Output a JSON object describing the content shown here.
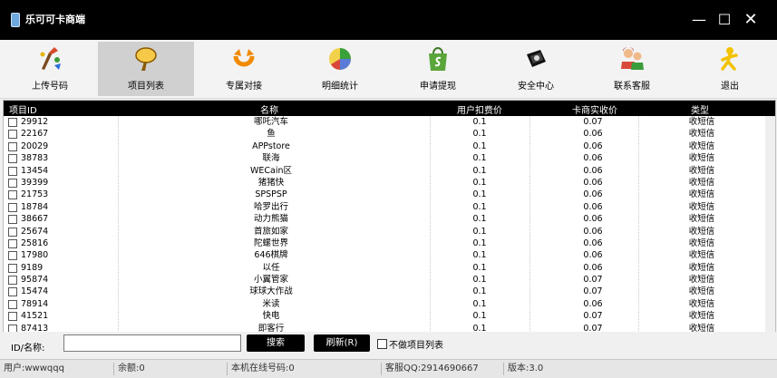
{
  "window": {
    "title": "乐可可卡商端",
    "minimize": "—",
    "maximize": "☐",
    "close": "✕"
  },
  "toolbar": [
    {
      "label": "上传号码",
      "icon": "upload-icon"
    },
    {
      "label": "项目列表",
      "icon": "magnifier-icon",
      "active": true
    },
    {
      "label": "专属对接",
      "icon": "dock-icon"
    },
    {
      "label": "明细统计",
      "icon": "pie-chart-icon"
    },
    {
      "label": "申请提现",
      "icon": "shopify-bag-icon"
    },
    {
      "label": "安全中心",
      "icon": "security-icon"
    },
    {
      "label": "联系客服",
      "icon": "support-icon"
    },
    {
      "label": "退出",
      "icon": "exit-icon"
    }
  ],
  "table": {
    "headers": {
      "id": "项目ID",
      "name": "名称",
      "price": "用户扣费价",
      "cost": "卡商实收价",
      "type": "类型"
    },
    "rows": [
      [
        "29912",
        "哪吒汽车",
        "0.1",
        "0.07",
        "收短信"
      ],
      [
        "22167",
        "鱼",
        "0.1",
        "0.06",
        "收短信"
      ],
      [
        "20029",
        "APPstore",
        "0.1",
        "0.06",
        "收短信"
      ],
      [
        "38783",
        "联海",
        "0.1",
        "0.06",
        "收短信"
      ],
      [
        "13454",
        "WECain区",
        "0.1",
        "0.06",
        "收短信"
      ],
      [
        "39399",
        "猪猪快",
        "0.1",
        "0.06",
        "收短信"
      ],
      [
        "21753",
        "SPSPSP",
        "0.1",
        "0.06",
        "收短信"
      ],
      [
        "18784",
        "哈罗出行",
        "0.1",
        "0.06",
        "收短信"
      ],
      [
        "38667",
        "动力熊猫",
        "0.1",
        "0.06",
        "收短信"
      ],
      [
        "25674",
        "首旅如家",
        "0.1",
        "0.06",
        "收短信"
      ],
      [
        "25816",
        "陀螺世界",
        "0.1",
        "0.06",
        "收短信"
      ],
      [
        "17980",
        "646棋牌",
        "0.1",
        "0.06",
        "收短信"
      ],
      [
        "9189",
        "以任",
        "0.1",
        "0.06",
        "收短信"
      ],
      [
        "95874",
        "小翼管家",
        "0.1",
        "0.07",
        "收短信"
      ],
      [
        "15474",
        "球球大作战",
        "0.1",
        "0.07",
        "收短信"
      ],
      [
        "78914",
        "米读",
        "0.1",
        "0.06",
        "收短信"
      ],
      [
        "41521",
        "快电",
        "0.1",
        "0.07",
        "收短信"
      ],
      [
        "87413",
        "即客行",
        "0.1",
        "0.07",
        "收短信"
      ]
    ]
  },
  "search": {
    "label": "ID/名称:",
    "value": "",
    "search_button": "搜索",
    "refresh_button": "刷新(R)",
    "no_list_checkbox": "不做项目列表"
  },
  "status": {
    "user": "用户:wwwqqq",
    "balance": "余额:0",
    "online": "本机在线号码:0",
    "support_qq": "客服QQ:2914690667",
    "version": "版本:3.0"
  }
}
